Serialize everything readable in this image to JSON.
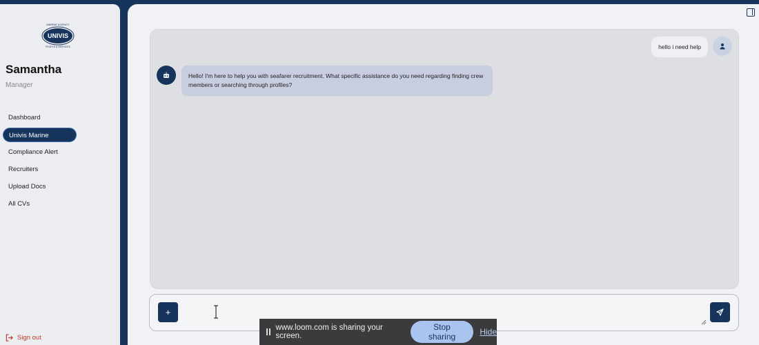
{
  "sidebar": {
    "logo": {
      "brand": "UNIVIS",
      "tagline_top": "MARINE AGENCY",
      "tagline_bottom": "PEOPLE & SERVICES"
    },
    "user": {
      "name": "Samantha",
      "role": "Manager"
    },
    "nav": [
      {
        "label": "Dashboard",
        "active": false
      },
      {
        "label": "Univis Marine",
        "active": true
      },
      {
        "label": "Compliance Alert",
        "active": false
      },
      {
        "label": "Recruiters",
        "active": false
      },
      {
        "label": "Upload Docs",
        "active": false
      },
      {
        "label": "All CVs",
        "active": false
      }
    ],
    "sign_out": "Sign out"
  },
  "chat": {
    "messages": [
      {
        "role": "user",
        "text": "hello i need help"
      },
      {
        "role": "assistant",
        "text": "Hello! I'm here to help you with seafarer recruitment. What specific assistance do you need regarding finding crew members or searching through profiles?"
      }
    ]
  },
  "input": {
    "value": "",
    "placeholder": ""
  },
  "share_bar": {
    "text": "www.loom.com is sharing your screen.",
    "stop_label": "Stop sharing",
    "hide_label": "Hide"
  },
  "colors": {
    "primary": "#17345c",
    "bot_bubble": "#c8cee0",
    "chat_bg": "#dedfe3",
    "danger": "#c0392b"
  }
}
